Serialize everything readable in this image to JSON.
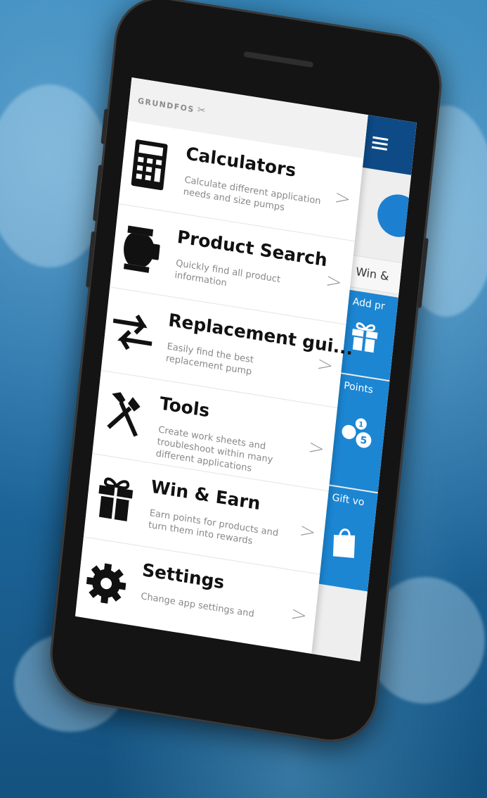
{
  "app": {
    "logo_text": "GRUNDFOS",
    "logo_mark": "✂"
  },
  "menu": {
    "items": [
      {
        "title": "Calculators",
        "desc": "Calculate different application needs and size pumps",
        "icon": "calculator-icon"
      },
      {
        "title": "Product Search",
        "desc": "Quickly find all product information",
        "icon": "pump-icon"
      },
      {
        "title": "Replacement gui...",
        "desc": "Easily find the best replacement pump",
        "icon": "swap-arrows-icon"
      },
      {
        "title": "Tools",
        "desc": "Create work sheets and troubleshoot within many different applications",
        "icon": "tools-icon"
      },
      {
        "title": "Win & Earn",
        "desc": "Earn points for products and turn them into rewards",
        "icon": "gift-icon"
      },
      {
        "title": "Settings",
        "desc": "Change app settings and",
        "icon": "gear-icon"
      }
    ],
    "chevron": ">"
  },
  "right_pane": {
    "win_label": "Win &",
    "tiles": [
      {
        "label": "Add pr",
        "icon": "gift-icon"
      },
      {
        "label": "Points",
        "icon": "points-icon"
      },
      {
        "label": "Gift vo",
        "icon": "shopping-bag-icon"
      }
    ]
  },
  "colors": {
    "header_blue": "#0e4a86",
    "tile_blue": "#1c86d3",
    "background_water": "#1f6aa0"
  }
}
